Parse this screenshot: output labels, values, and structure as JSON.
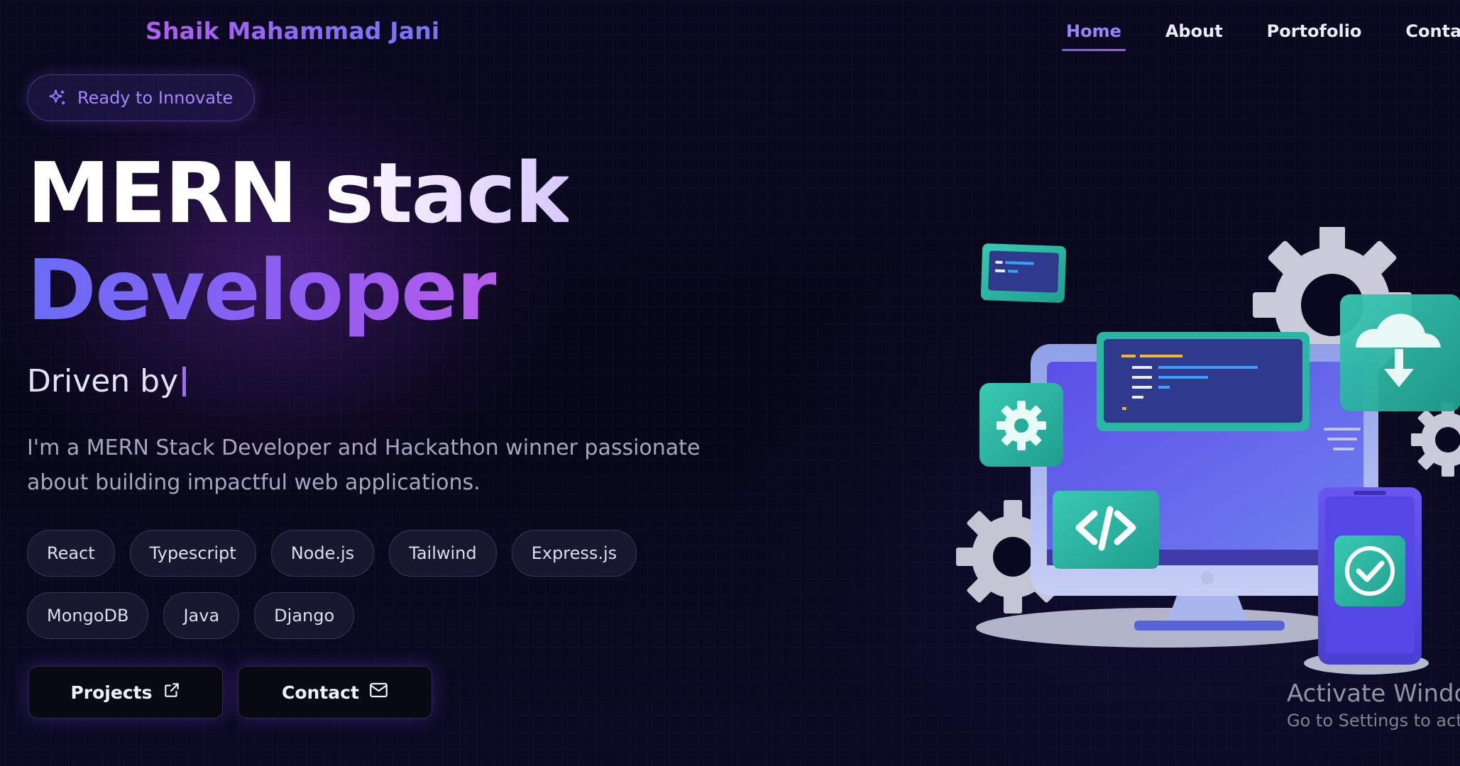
{
  "brand": {
    "name": "Shaik Mahammad Jani"
  },
  "nav": {
    "items": [
      {
        "label": "Home",
        "active": true
      },
      {
        "label": "About",
        "active": false
      },
      {
        "label": "Portofolio",
        "active": false
      },
      {
        "label": "Contact",
        "active": false
      }
    ]
  },
  "hero": {
    "badge": {
      "label": "Ready to Innovate",
      "icon": "sparkle-icon"
    },
    "title_line1_word1": "MERN",
    "title_line1_word2": "stack",
    "title_line2": "Developer",
    "typing_prefix": "Driven by",
    "description": "I'm a MERN Stack Developer and Hackathon winner passionate about building impactful web applications.",
    "tags": [
      "React",
      "Typescript",
      "Node.js",
      "Tailwind",
      "Express.js",
      "MongoDB",
      "Java",
      "Django"
    ],
    "buttons": {
      "projects": {
        "label": "Projects",
        "icon": "external-link-icon"
      },
      "contact": {
        "label": "Contact",
        "icon": "mail-icon"
      }
    },
    "illustration": "developer-workstation-illustration"
  },
  "os_watermark": {
    "title": "Activate Window",
    "subtitle": "Go to Settings to acti"
  },
  "colors": {
    "background": "#07061a",
    "accent_purple": "#8d5ef2",
    "accent_blue": "#6a6cf6",
    "accent_teal": "#2bb6a3",
    "nav_active": "#9f82ff"
  }
}
